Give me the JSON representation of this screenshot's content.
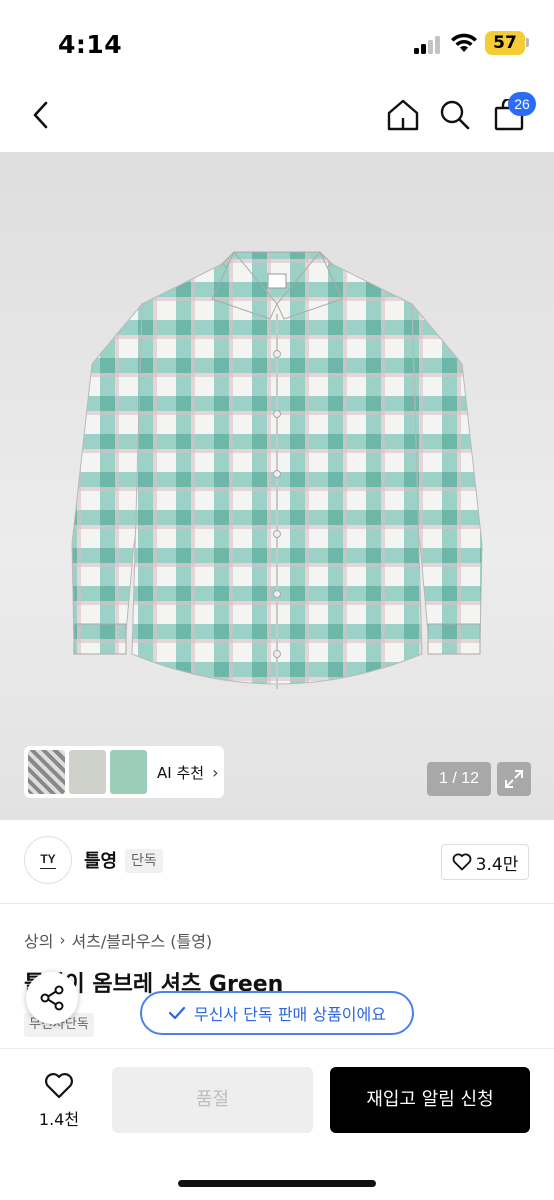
{
  "status_bar": {
    "time": "4:14",
    "battery": "57"
  },
  "nav": {
    "back_icon": "chevron-left-icon",
    "home_icon": "home-icon",
    "search_icon": "search-icon",
    "cart_icon": "shopping-bag-icon",
    "cart_count": "26"
  },
  "gallery": {
    "ai_label": "AI 추천",
    "page_indicator": "1 / 12",
    "expand_icon": "expand-icon"
  },
  "brand": {
    "logo_text": "TY",
    "name": "틀영",
    "badge": "단독",
    "like_count": "3.4만"
  },
  "product": {
    "breadcrumb": [
      "상의",
      "셔츠/블라우스 (틀영)"
    ],
    "title": "옴브레 셔츠 Green",
    "title_prefix": "틀영이",
    "tag": "무신사단독"
  },
  "toast": {
    "text": "무신사 단독 판매 상품이에요"
  },
  "bottom_bar": {
    "wish_count": "1.4천",
    "soldout_label": "품절",
    "restock_label": "재입고 알림 신청"
  },
  "colors": {
    "accent_blue": "#2a6cf6",
    "shirt_green": "#7fc4b8",
    "battery": "#f4cd36"
  }
}
